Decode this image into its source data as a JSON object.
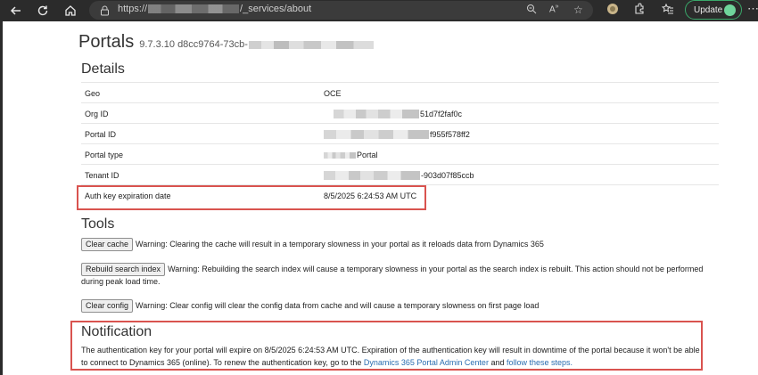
{
  "browser": {
    "url_prefix": "https://",
    "url_suffix": "/_services/about",
    "update_label": "Update"
  },
  "page": {
    "title": "Portals",
    "version": "9.7.3.10 d8cc9764-73cb-"
  },
  "details": {
    "heading": "Details",
    "rows": [
      {
        "label": "Geo",
        "value": "OCE"
      },
      {
        "label": "Org ID",
        "value": "51d7f2faf0c"
      },
      {
        "label": "Portal ID",
        "value": "f955f578ff2"
      },
      {
        "label": "Portal type",
        "value": "Portal"
      },
      {
        "label": "Tenant ID",
        "value": "-903d07f85ccb"
      },
      {
        "label": "Auth key expiration date",
        "value": "8/5/2025 6:24:53 AM UTC"
      }
    ]
  },
  "tools": {
    "heading": "Tools",
    "clear_cache_label": "Clear cache",
    "clear_cache_warning": "Warning: Clearing the cache will result in a temporary slowness in your portal as it reloads data from Dynamics 365",
    "rebuild_label": "Rebuild search index",
    "rebuild_warning": "Warning: Rebuilding the search index will cause a temporary slowness in your portal as the search index is rebuilt. This action should not be performed during peak load time.",
    "clear_config_label": "Clear config",
    "clear_config_warning": "Warning: Clear config will clear the config data from cache and will cause a temporary slowness on first page load"
  },
  "notification": {
    "heading": "Notification",
    "text_1": "The authentication key for your portal will expire on 8/5/2025 6:24:53 AM UTC. Expiration of the authentication key will result in downtime of the portal because it won't be able to connect to Dynamics 365 (online). To renew the authentication key, go to the",
    "link_admin": "Dynamics 365 Portal Admin Center",
    "text_2": "and",
    "link_steps": "follow these steps."
  },
  "colors": {
    "highlight": "#d9534f",
    "link": "#2a6db0",
    "chrome": "#2b2b2b"
  }
}
